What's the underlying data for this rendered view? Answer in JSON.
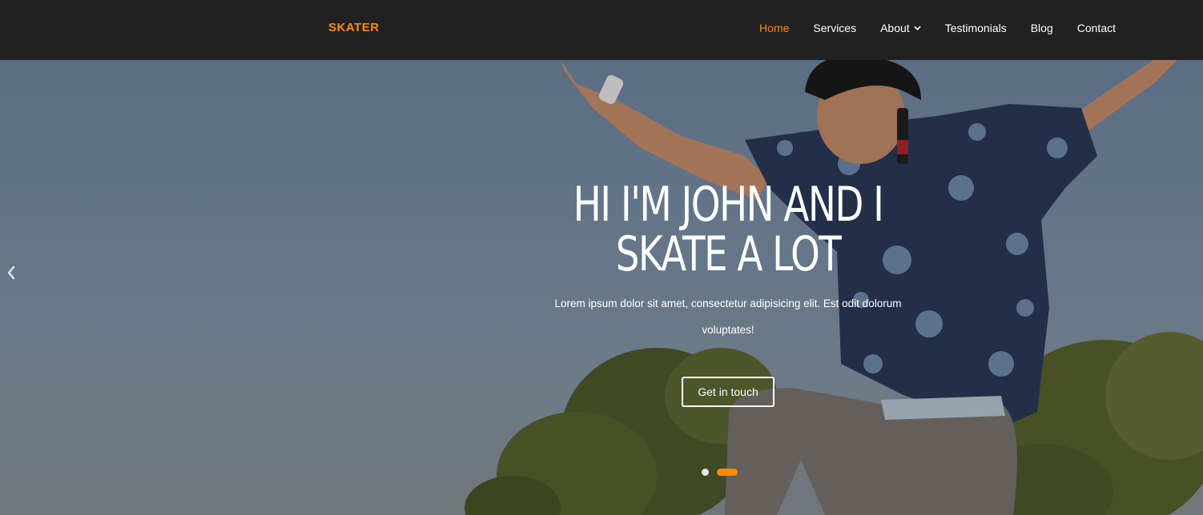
{
  "brand": {
    "name": "SKATER",
    "color": "#ff8a00"
  },
  "nav": {
    "items": [
      {
        "label": "Home",
        "active": true
      },
      {
        "label": "Services"
      },
      {
        "label": "About",
        "has_dropdown": true
      },
      {
        "label": "Testimonials"
      },
      {
        "label": "Blog"
      },
      {
        "label": "Contact"
      }
    ]
  },
  "hero": {
    "title_line1": "HI I'M JOHN AND I",
    "title_line2": "SKATE A LOT",
    "text": "Lorem ipsum dolor sit amet, consectetur adipisicing elit. Est odit dolorum voluptates!",
    "cta_label": "Get in touch",
    "prev_icon": "chevron-left-icon",
    "slides_count": 2,
    "active_slide": 2
  },
  "colors": {
    "accent": "#ff8a00",
    "navbar_bg": "#212121"
  }
}
